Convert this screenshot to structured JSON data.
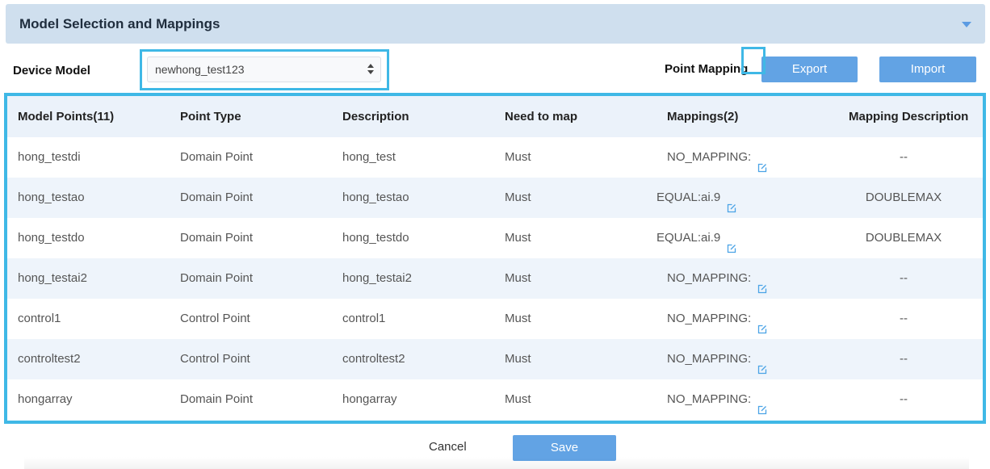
{
  "section": {
    "title": "Model Selection and Mappings"
  },
  "device_model": {
    "label": "Device Model",
    "selected": "newhong_test123"
  },
  "point_mapping": {
    "label": "Point Mapping",
    "export_label": "Export",
    "import_label": "Import"
  },
  "table": {
    "headers": [
      "Model Points(11)",
      "Point Type",
      "Description",
      "Need to map",
      "Mappings(2)",
      "Mapping Description"
    ],
    "rows": [
      {
        "point": "hong_testdi",
        "type": "Domain Point",
        "description": "hong_test",
        "need": "Must",
        "mapping": "NO_MAPPING:",
        "mapping_desc": "--"
      },
      {
        "point": "hong_testao",
        "type": "Domain Point",
        "description": "hong_testao",
        "need": "Must",
        "mapping": "EQUAL:ai.9",
        "mapping_desc": "DOUBLEMAX"
      },
      {
        "point": "hong_testdo",
        "type": "Domain Point",
        "description": "hong_testdo",
        "need": "Must",
        "mapping": "EQUAL:ai.9",
        "mapping_desc": "DOUBLEMAX"
      },
      {
        "point": "hong_testai2",
        "type": "Domain Point",
        "description": "hong_testai2",
        "need": "Must",
        "mapping": "NO_MAPPING:",
        "mapping_desc": "--"
      },
      {
        "point": "control1",
        "type": "Control Point",
        "description": "control1",
        "need": "Must",
        "mapping": "NO_MAPPING:",
        "mapping_desc": "--"
      },
      {
        "point": "controltest2",
        "type": "Control Point",
        "description": "controltest2",
        "need": "Must",
        "mapping": "NO_MAPPING:",
        "mapping_desc": "--"
      },
      {
        "point": "hongarray",
        "type": "Domain Point",
        "description": "hongarray",
        "need": "Must",
        "mapping": "NO_MAPPING:",
        "mapping_desc": "--"
      }
    ]
  },
  "footer": {
    "cancel_label": "Cancel",
    "save_label": "Save"
  },
  "icons": {
    "collapse": "chevron-down-icon",
    "edit": "edit-icon",
    "select_arrows": "sort-arrows-icon"
  },
  "colors": {
    "header_bg": "#cfdfee",
    "button": "#62a3e4",
    "highlight": "#3fb8e6",
    "row_alt": "#eef4fb"
  }
}
